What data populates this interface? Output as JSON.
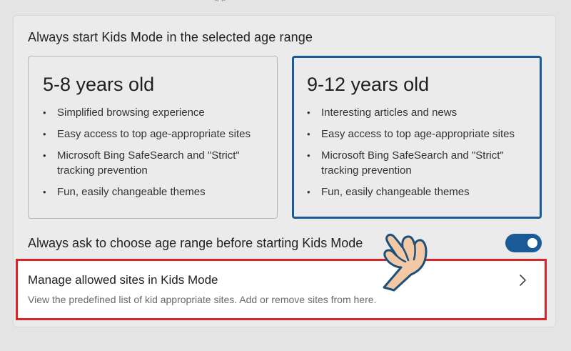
{
  "top_fragment": "g   p",
  "section": {
    "title": "Always start Kids Mode in the selected age range"
  },
  "age_ranges": [
    {
      "title": "5-8 years old",
      "selected": false,
      "bullets": [
        "Simplified browsing experience",
        "Easy access to top age-appropriate sites",
        "Microsoft Bing SafeSearch and \"Strict\" tracking prevention",
        "Fun, easily changeable themes"
      ]
    },
    {
      "title": "9-12 years old",
      "selected": true,
      "bullets": [
        "Interesting articles and news",
        "Easy access to top age-appropriate sites",
        "Microsoft Bing SafeSearch and \"Strict\" tracking prevention",
        "Fun, easily changeable themes"
      ]
    }
  ],
  "ask_row": {
    "label": "Always ask to choose age range before starting Kids Mode",
    "toggle_on": true
  },
  "manage_row": {
    "title": "Manage allowed sites in Kids Mode",
    "description": "View the predefined list of kid appropriate sites. Add or remove sites from here.",
    "chevron_icon": "chevron-right-icon"
  },
  "colors": {
    "accent": "#1a5a96",
    "highlight_border": "#d7262b",
    "hand_fill": "#f3c9a5",
    "hand_outline": "#1c4f7a"
  }
}
